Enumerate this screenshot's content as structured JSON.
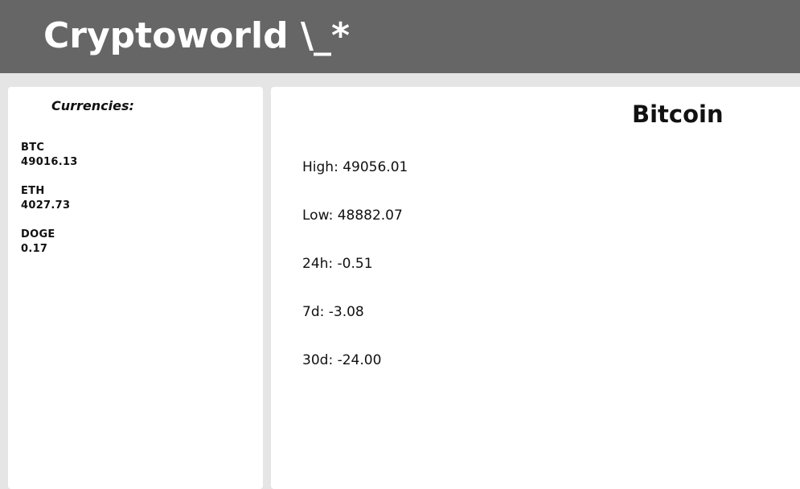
{
  "header": {
    "title": "Cryptoworld \\_*"
  },
  "sidebar": {
    "heading": "Currencies:",
    "currencies": [
      {
        "symbol": "BTC",
        "price": "49016.13"
      },
      {
        "symbol": "ETH",
        "price": "4027.73"
      },
      {
        "symbol": "DOGE",
        "price": "0.17"
      }
    ]
  },
  "detail": {
    "name": "Bitcoin",
    "stats": [
      {
        "label": "High",
        "value": "49056.01"
      },
      {
        "label": "Low",
        "value": "48882.07"
      },
      {
        "label": "24h",
        "value": "-0.51"
      },
      {
        "label": "7d",
        "value": "-3.08"
      },
      {
        "label": "30d",
        "value": "-24.00"
      }
    ]
  },
  "colors": {
    "header_bg": "#666666",
    "page_bg": "#e5e5e5",
    "panel_bg": "#ffffff"
  }
}
